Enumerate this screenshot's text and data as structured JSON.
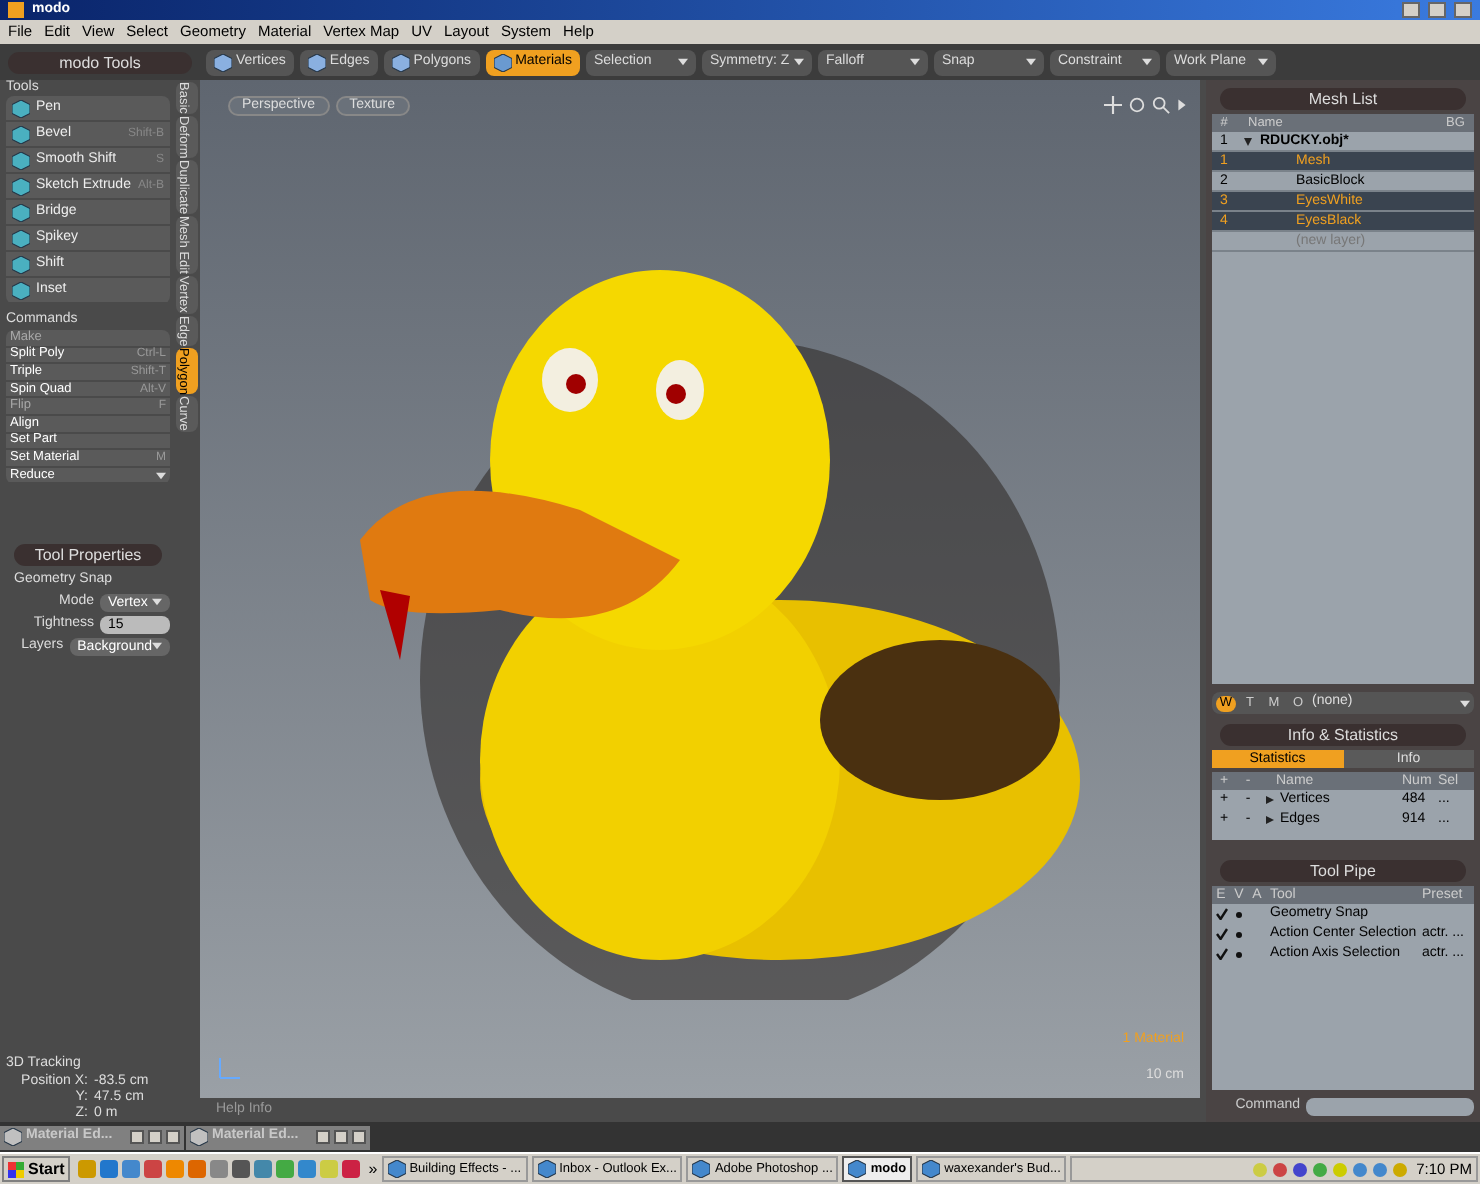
{
  "window": {
    "title": "modo"
  },
  "menu": [
    "File",
    "Edit",
    "View",
    "Select",
    "Geometry",
    "Material",
    "Vertex Map",
    "UV",
    "Layout",
    "System",
    "Help"
  ],
  "left_panel": {
    "title": "modo Tools",
    "tools_label": "Tools",
    "tools": [
      {
        "label": "Pen"
      },
      {
        "label": "Bevel",
        "shortcut": "Shift-B"
      },
      {
        "label": "Smooth Shift",
        "shortcut": "S"
      },
      {
        "label": "Sketch Extrude",
        "shortcut": "Alt-B"
      },
      {
        "label": "Bridge"
      },
      {
        "label": "Spikey"
      },
      {
        "label": "Shift"
      },
      {
        "label": "Inset"
      }
    ],
    "commands_label": "Commands",
    "commands": [
      {
        "label": "Make",
        "disabled": true,
        "kind": "item"
      },
      {
        "label": "Split Poly",
        "shortcut": "Ctrl-L",
        "disabled": false,
        "kind": "item"
      },
      {
        "label": "Triple",
        "shortcut": "Shift-T",
        "disabled": false,
        "kind": "item"
      },
      {
        "label": "Spin Quad",
        "shortcut": "Alt-V",
        "disabled": false,
        "kind": "item"
      },
      {
        "label": "Flip",
        "shortcut": "F",
        "disabled": true,
        "kind": "item"
      },
      {
        "label": "Align",
        "disabled": false,
        "kind": "item"
      },
      {
        "label": "Set Part",
        "disabled": false,
        "kind": "item"
      },
      {
        "label": "Set Material",
        "shortcut": "M",
        "disabled": false,
        "kind": "item"
      },
      {
        "label": "Reduce",
        "disabled": false,
        "kind": "dropdown"
      }
    ],
    "side_tabs": [
      {
        "label": "Basic",
        "selected": false
      },
      {
        "label": "Deform",
        "selected": false
      },
      {
        "label": "Duplicate",
        "selected": false
      },
      {
        "label": "Mesh Edit",
        "selected": false
      },
      {
        "label": "Vertex",
        "selected": false
      },
      {
        "label": "Edge",
        "selected": false
      },
      {
        "label": "Polygon",
        "selected": true
      },
      {
        "label": "Curve",
        "selected": false
      }
    ],
    "tool_properties": {
      "title": "Tool Properties",
      "section": "Geometry Snap",
      "fields": [
        {
          "label": "Mode",
          "value": "Vertex",
          "kind": "dropdown"
        },
        {
          "label": "Tightness",
          "value": "15",
          "kind": "number"
        },
        {
          "label": "Layers",
          "value": "Background",
          "kind": "dropdown"
        }
      ]
    },
    "tracking": {
      "title": "3D Tracking",
      "lines": [
        {
          "label": "Position X:",
          "value": "-83.5 cm"
        },
        {
          "label": "Y:",
          "value": "47.5 cm"
        },
        {
          "label": "Z:",
          "value": "0 m"
        }
      ]
    }
  },
  "toolbar": {
    "modes": [
      {
        "label": "Vertices",
        "selected": false
      },
      {
        "label": "Edges",
        "selected": false
      },
      {
        "label": "Polygons",
        "selected": false
      },
      {
        "label": "Materials",
        "selected": true
      }
    ],
    "dropdowns": [
      "Selection",
      "Symmetry: Z",
      "Falloff",
      "Snap",
      "Constraint",
      "Work Plane"
    ]
  },
  "viewport": {
    "tabs": [
      "Perspective",
      "Texture"
    ],
    "material_label": "1 Material",
    "scale_label": "10 cm",
    "help": "Help Info"
  },
  "mesh_list": {
    "title": "Mesh List",
    "columns": [
      "#",
      "Name",
      "BG"
    ],
    "rows": [
      {
        "num": "1",
        "name": "RDUCKY.obj*",
        "kind": "scene",
        "selected": false
      },
      {
        "num": "1",
        "name": "Mesh",
        "kind": "layer",
        "selected": true
      },
      {
        "num": "2",
        "name": "BasicBlock",
        "kind": "layer",
        "selected": false
      },
      {
        "num": "3",
        "name": "EyesWhite",
        "kind": "layer",
        "selected": true
      },
      {
        "num": "4",
        "name": "EyesBlack",
        "kind": "layer",
        "selected": true
      },
      {
        "name": "(new layer)",
        "kind": "new",
        "selected": false
      }
    ]
  },
  "filter_bar": {
    "buttons": [
      {
        "label": "W",
        "selected": true
      },
      {
        "label": "T",
        "selected": false
      },
      {
        "label": "M",
        "selected": false
      },
      {
        "label": "O",
        "selected": false
      }
    ],
    "value": "(none)"
  },
  "info": {
    "title": "Info & Statistics",
    "tabs": [
      {
        "label": "Statistics",
        "selected": true
      },
      {
        "label": "Info",
        "selected": false
      }
    ],
    "columns": [
      "+",
      "-",
      "Name",
      "Num",
      "Sel"
    ],
    "rows": [
      {
        "plus": "+",
        "minus": "-",
        "name": "Vertices",
        "num": "484",
        "sel": "..."
      },
      {
        "plus": "+",
        "minus": "-",
        "name": "Edges",
        "num": "914",
        "sel": "..."
      }
    ]
  },
  "tool_pipe": {
    "title": "Tool Pipe",
    "columns": [
      "E",
      "V",
      "A",
      "Tool",
      "Preset"
    ],
    "rows": [
      {
        "enabled": true,
        "visible": true,
        "tool": "Geometry Snap"
      },
      {
        "enabled": true,
        "visible": true,
        "tool": "Action Center Selection",
        "preset": "actr. ..."
      },
      {
        "enabled": true,
        "visible": true,
        "tool": "Action Axis Selection",
        "preset": "actr. ..."
      }
    ]
  },
  "command": {
    "label": "Command"
  },
  "minimized_windows": [
    {
      "title": "Material Ed..."
    },
    {
      "title": "Material Ed..."
    }
  ],
  "taskbar": {
    "start": "Start",
    "more": "»",
    "tasks": [
      {
        "label": "Building Effects - ...",
        "selected": false
      },
      {
        "label": "Inbox - Outlook Ex...",
        "selected": false
      },
      {
        "label": "Adobe Photoshop ...",
        "selected": false
      },
      {
        "label": "modo",
        "selected": true
      },
      {
        "label": "waxexander's Bud...",
        "selected": false
      }
    ],
    "clock": "7:10 PM"
  }
}
